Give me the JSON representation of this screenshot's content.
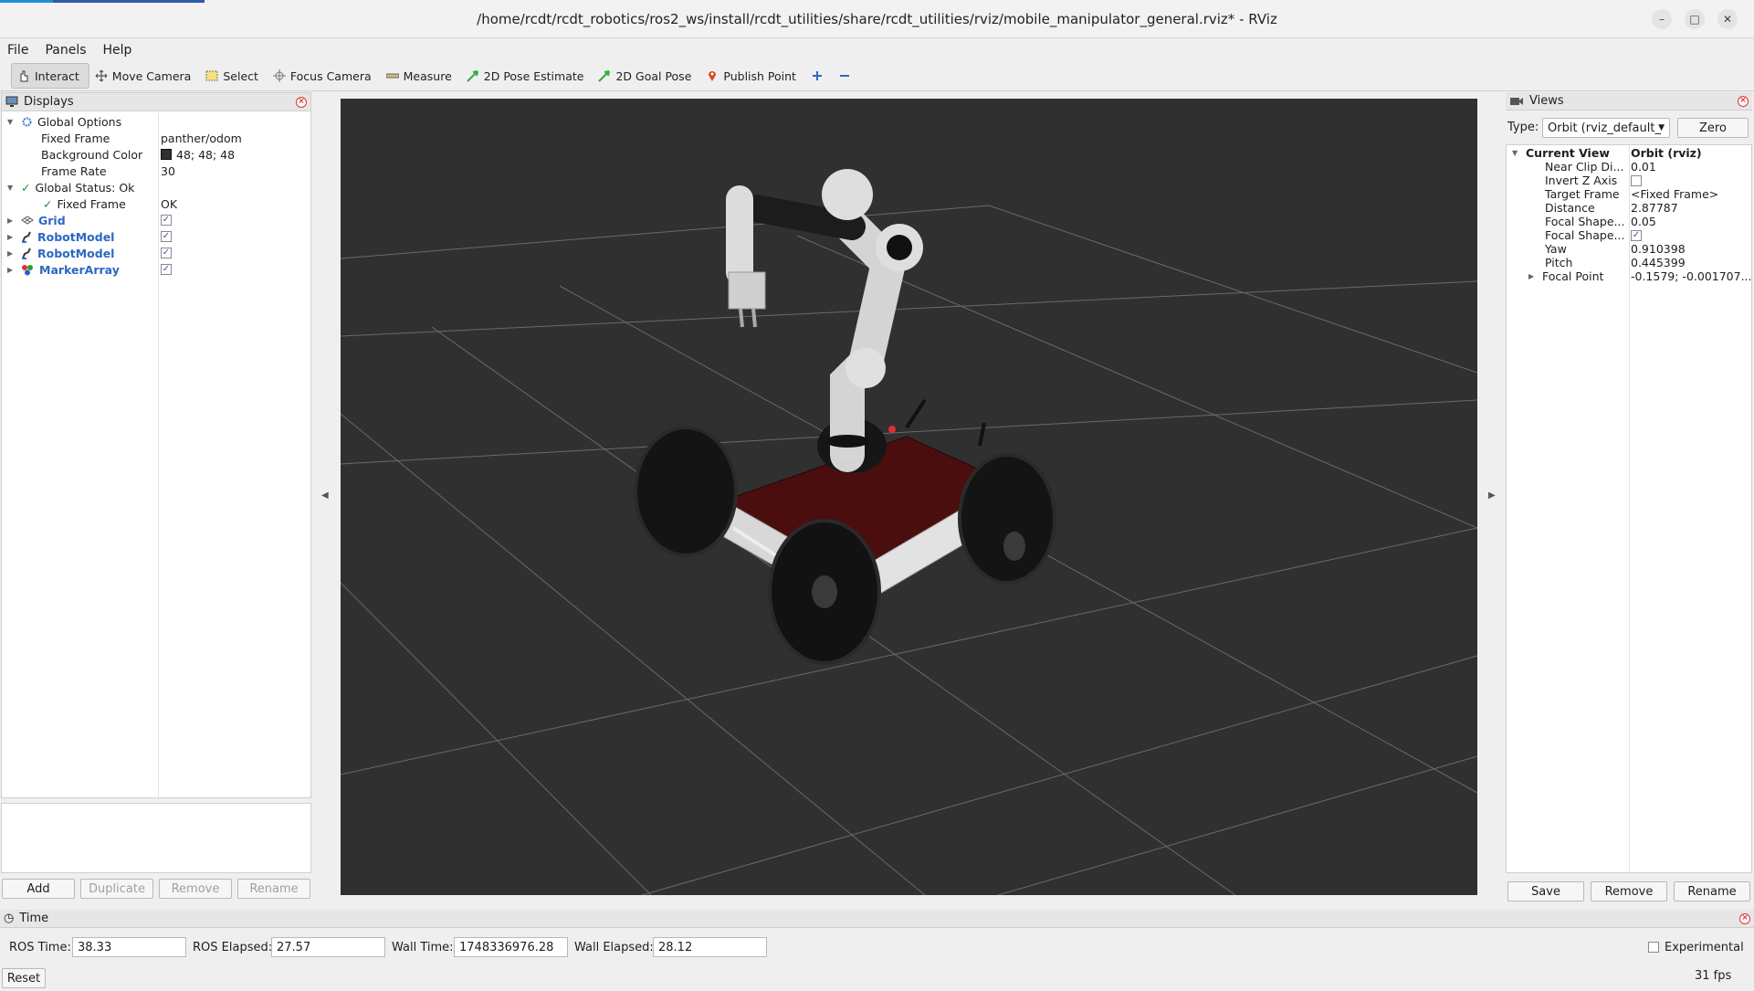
{
  "window": {
    "title": "/home/rcdt/rcdt_robotics/ros2_ws/install/rcdt_utilities/share/rcdt_utilities/rviz/mobile_manipulator_general.rviz* - RViz"
  },
  "menu": {
    "file": "File",
    "panels": "Panels",
    "help": "Help"
  },
  "toolbar": {
    "interact": "Interact",
    "move_camera": "Move Camera",
    "select": "Select",
    "focus_camera": "Focus Camera",
    "measure": "Measure",
    "pose_estimate": "2D Pose Estimate",
    "goal_pose": "2D Goal Pose",
    "publish_point": "Publish Point"
  },
  "displays": {
    "title": "Displays",
    "global_options": "Global Options",
    "fixed_frame_label": "Fixed Frame",
    "fixed_frame_value": "panther/odom",
    "bg_color_label": "Background Color",
    "bg_color_value": "48; 48; 48",
    "frame_rate_label": "Frame Rate",
    "frame_rate_value": "30",
    "global_status": "Global Status: Ok",
    "status_fixed_frame_label": "Fixed Frame",
    "status_fixed_frame_value": "OK",
    "items": [
      {
        "label": "Grid",
        "checked": true
      },
      {
        "label": "RobotModel",
        "checked": true
      },
      {
        "label": "RobotModel",
        "checked": true
      },
      {
        "label": "MarkerArray",
        "checked": true
      }
    ],
    "buttons": {
      "add": "Add",
      "duplicate": "Duplicate",
      "remove": "Remove",
      "rename": "Rename"
    }
  },
  "views": {
    "title": "Views",
    "type_label": "Type:",
    "type_value": "Orbit (rviz_default_",
    "zero": "Zero",
    "current_view_label": "Current View",
    "current_view_value": "Orbit (rviz)",
    "props": [
      {
        "label": "Near Clip Di...",
        "value": "0.01"
      },
      {
        "label": "Invert Z Axis",
        "value": ""
      },
      {
        "label": "Target Frame",
        "value": "<Fixed Frame>"
      },
      {
        "label": "Distance",
        "value": "2.87787"
      },
      {
        "label": "Focal Shape...",
        "value": "0.05"
      },
      {
        "label": "Focal Shape...",
        "value": ""
      },
      {
        "label": "Yaw",
        "value": "0.910398"
      },
      {
        "label": "Pitch",
        "value": "0.445399"
      },
      {
        "label": "Focal Point",
        "value": "-0.1579; -0.001707..."
      }
    ],
    "buttons": {
      "save": "Save",
      "remove": "Remove",
      "rename": "Rename"
    }
  },
  "time": {
    "title": "Time",
    "ros_time_label": "ROS Time:",
    "ros_time": "38.33",
    "ros_elapsed_label": "ROS Elapsed:",
    "ros_elapsed": "27.57",
    "wall_time_label": "Wall Time:",
    "wall_time": "1748336976.28",
    "wall_elapsed_label": "Wall Elapsed:",
    "wall_elapsed": "28.12",
    "experimental": "Experimental",
    "reset": "Reset",
    "fps": "31 fps"
  },
  "colors": {
    "viewport_bg": "#303030",
    "accent": "#2b68c4",
    "robot_red": "#5a0f0f"
  }
}
